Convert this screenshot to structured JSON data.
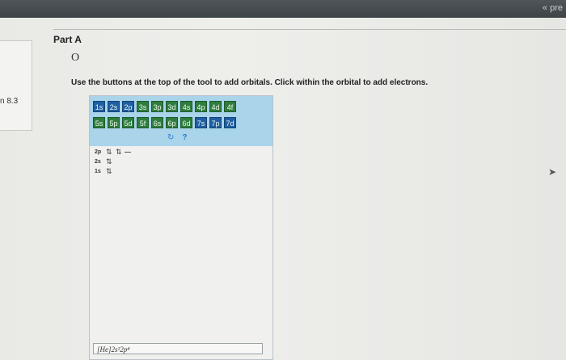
{
  "header": {
    "prev_label": "« pre"
  },
  "sidebar": {
    "label": "n 8.3"
  },
  "part": {
    "title": "Part A",
    "formula": "O",
    "instructions": "Use the buttons at the top of the tool to add orbitals. Click within the orbital to add electrons."
  },
  "tool": {
    "row1": [
      "1s",
      "2s",
      "2p",
      "3s",
      "3p",
      "3d",
      "4s",
      "4p",
      "4d",
      "4f"
    ],
    "row2": [
      "5s",
      "5p",
      "5d",
      "5f",
      "6s",
      "6p",
      "6d",
      "7s",
      "7p",
      "7d"
    ],
    "reset_icon": "↻",
    "help_icon": "?",
    "orbitals": [
      {
        "label": "2p",
        "boxes": "⇅ ⇅"
      },
      {
        "label": "2s",
        "boxes": "⇅"
      },
      {
        "label": "1s",
        "boxes": "⇅"
      }
    ],
    "configuration": "[He]2s²2p⁴"
  }
}
